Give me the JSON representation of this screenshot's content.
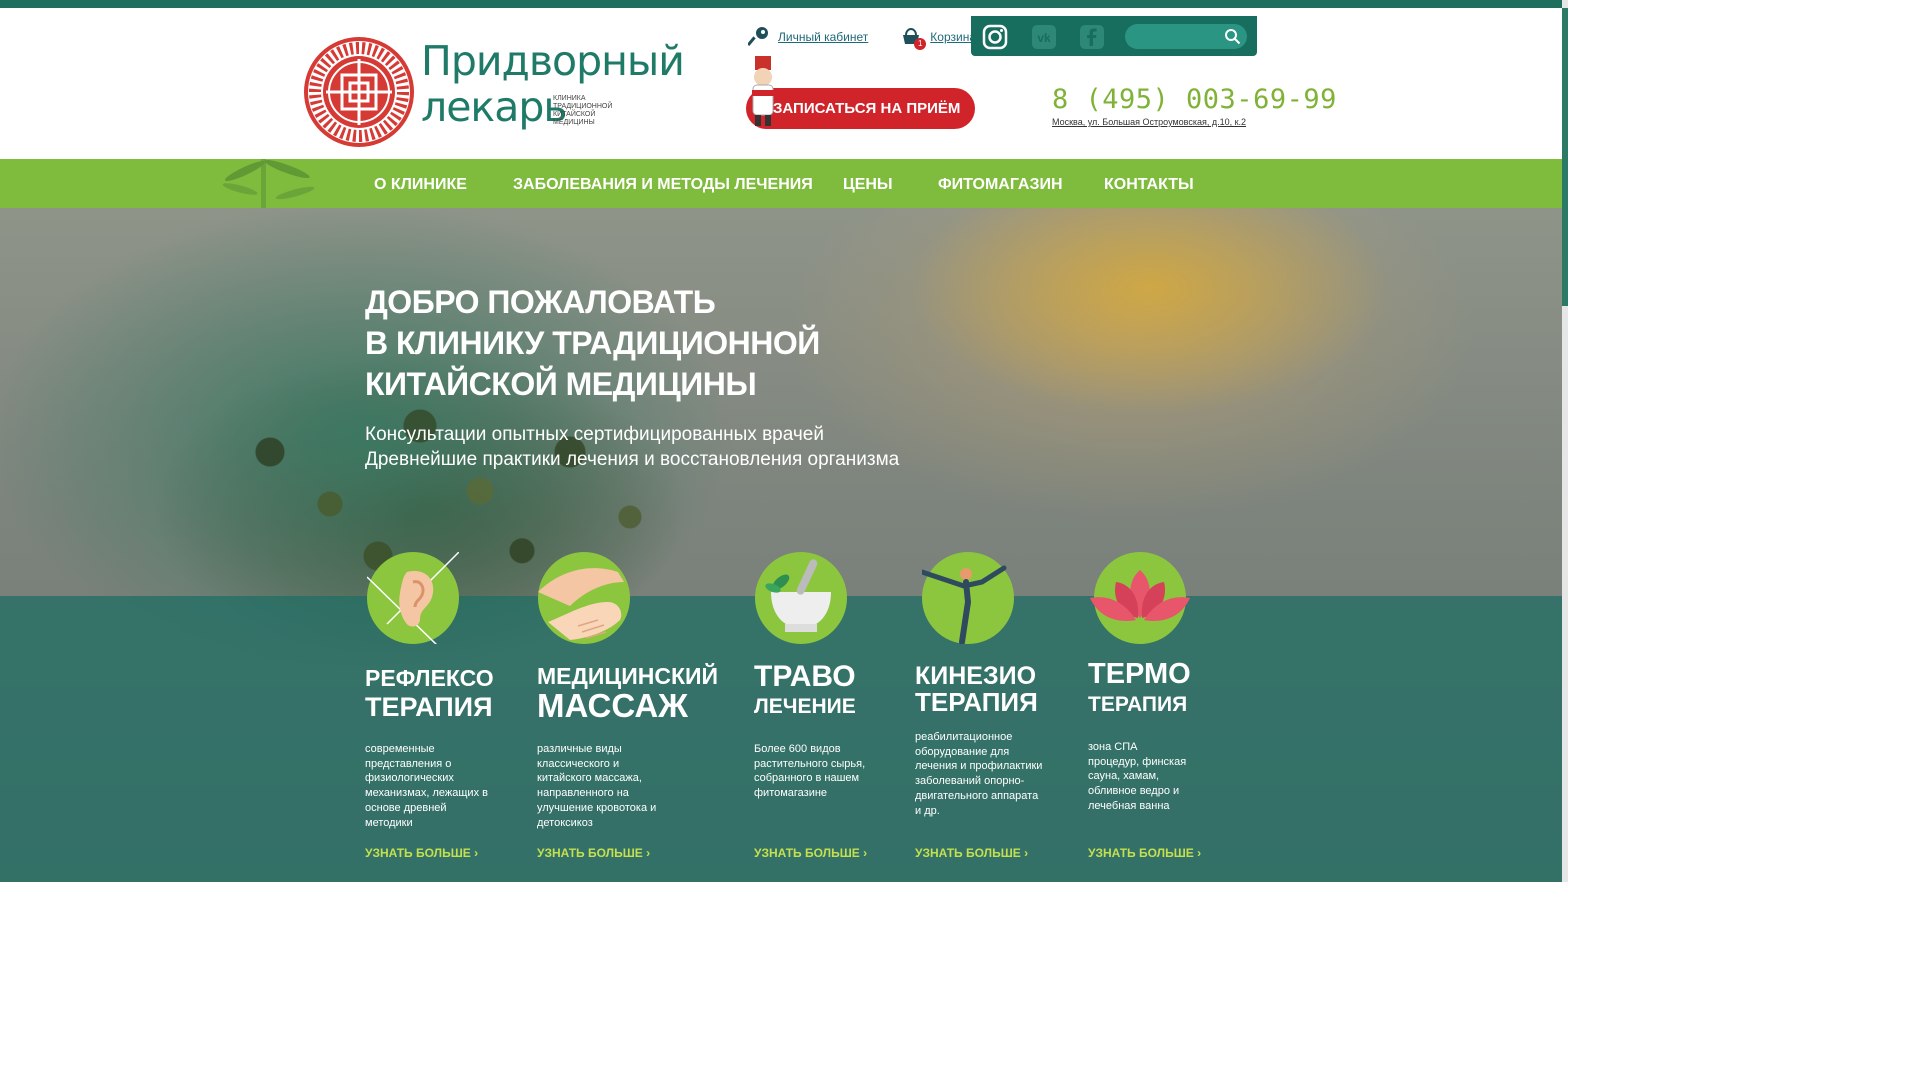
{
  "header": {
    "logo": {
      "name_line1": "Придворный",
      "name_line2": "лекарь",
      "subtitle": "КЛИНИКА ТРАДИЦИОННОЙ КИТАЙСКОЙ МЕДИЦИНЫ",
      "seal_text": "ПРИДВОРНЫЙ ЛЕКАРЬ"
    },
    "account_link": "Личный кабинет",
    "cart_link": "Корзина",
    "cart_count": "1",
    "appointment_button": "ЗАПИСАТЬСЯ НА ПРИЁМ",
    "phone": "8 (495) 003-69-99",
    "address": "Москва, ул. Большая Остроумовская, д.10, к.2",
    "social": [
      "instagram-icon",
      "vk-icon",
      "facebook-icon"
    ],
    "search": {
      "placeholder": "",
      "value": ""
    }
  },
  "nav": {
    "items": [
      "О КЛИНИКЕ",
      "ЗАБОЛЕВАНИЯ И МЕТОДЫ ЛЕЧЕНИЯ",
      "ЦЕНЫ",
      "ФИТОМАГАЗИН",
      "КОНТАКТЫ"
    ]
  },
  "hero": {
    "title": [
      "ДОБРО ПОЖАЛОВАТЬ",
      "В КЛИНИКУ ТРАДИЦИОННОЙ",
      "КИТАЙСКОЙ МЕДИЦИНЫ"
    ],
    "subtitle": [
      "Консультации опытных сертифицированных врачей",
      "Древнейшие практики лечения и восстановления организма"
    ]
  },
  "services": [
    {
      "title1": "РЕФЛЕКСО",
      "title2": "ТЕРАПИЯ",
      "description": "современные представления о физиологических механизмах, лежащих в основе древней методики",
      "more": "УЗНАТЬ БОЛЬШЕ",
      "icon": "ear-icon"
    },
    {
      "title1": "МЕДИЦИНСКИЙ",
      "title2": "МАССАЖ",
      "description": "различные виды классического и китайского массажа, направленного на улучшение кровотока и детоксикоз",
      "more": "УЗНАТЬ БОЛЬШЕ",
      "icon": "massage-hands-icon"
    },
    {
      "title1": "ТРАВО",
      "title2": "ЛЕЧЕНИЕ",
      "description": "Более 600 видов растительного сырья, собранного в нашем фитомагазине",
      "more": "УЗНАТЬ БОЛЬШЕ",
      "icon": "mortar-icon"
    },
    {
      "title1": "КИНЕЗИО",
      "title2": "ТЕРАПИЯ",
      "description": "реабилитационное оборудование для лечения и профилактики заболеваний опорно-двигательного аппарата и др.",
      "more": "УЗНАТЬ БОЛЬШЕ",
      "icon": "yoga-pose-icon"
    },
    {
      "title1": "ТЕРМО",
      "title2": "ТЕРАПИЯ",
      "description": "зона СПА процедур, финская сауна, хамам, обливное ведро и лечебная ванна",
      "more": "УЗНАТЬ БОЛЬШЕ",
      "icon": "lotus-icon"
    }
  ],
  "colors": {
    "brand_green": "#1f7a68",
    "nav_green": "#7fbb3c",
    "accent_red": "#d1232a",
    "link_lime": "#c4e04f",
    "phone_green": "#7fb237"
  }
}
